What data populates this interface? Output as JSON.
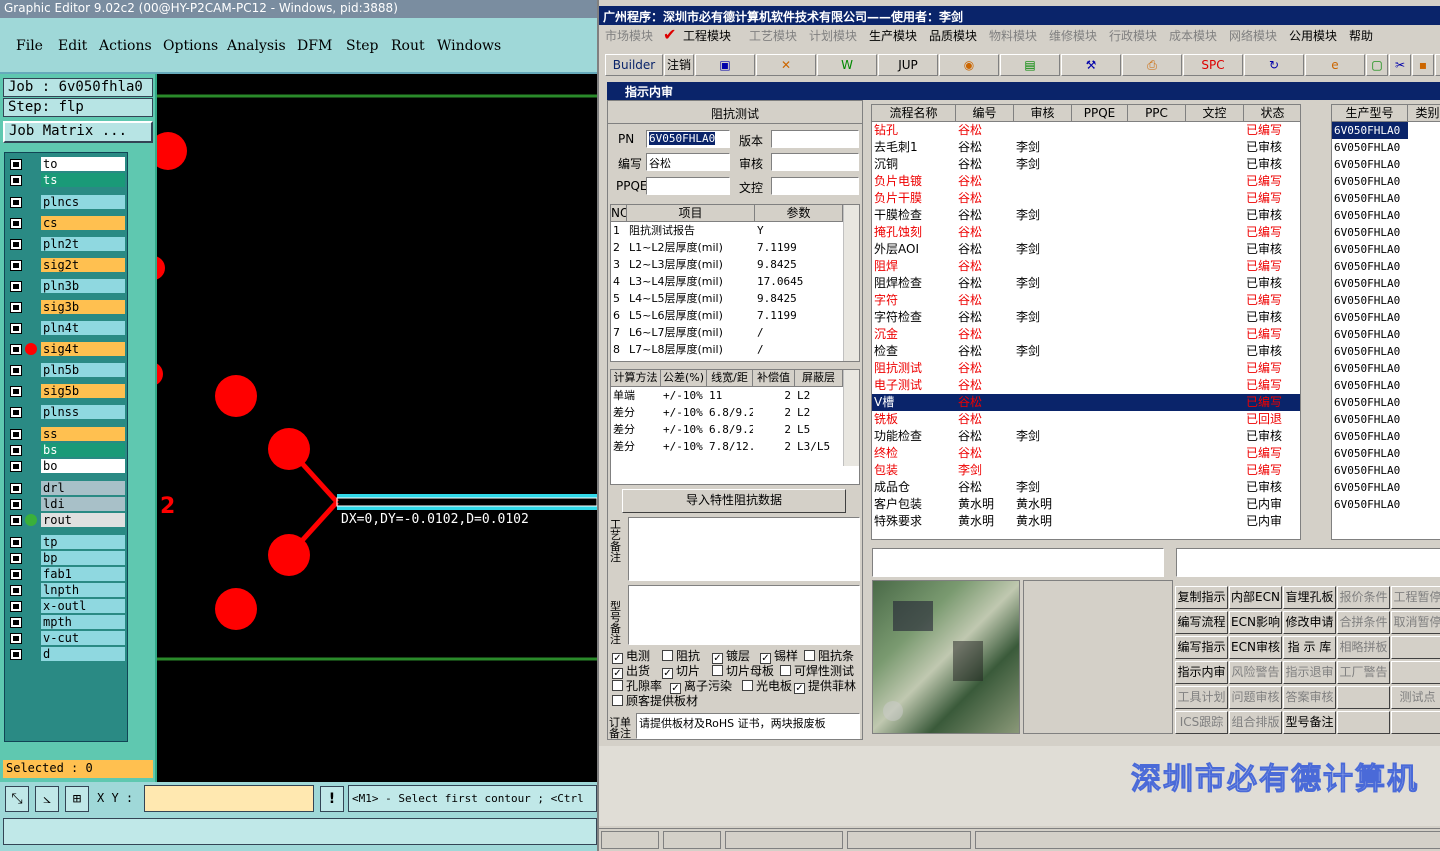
{
  "ge": {
    "title": "Graphic Editor 9.02c2 (00@HY-P2CAM-PC12 - Windows, pid:3888)",
    "menu": [
      "File",
      "Edit",
      "Actions",
      "Options",
      "Analysis",
      "DFM",
      "Step",
      "Rout",
      "Windows"
    ],
    "job": "Job  : 6v050fhla0",
    "step": "Step: flp",
    "job_matrix": "Job Matrix ...",
    "layers": [
      {
        "name": "to",
        "color": "#ffffff"
      },
      {
        "name": "ts",
        "color": "#1a9a78"
      },
      {
        "name": "plncs",
        "color": "#8fd8e0"
      },
      {
        "name": "cs",
        "color": "#ffc050"
      },
      {
        "name": "pln2t",
        "color": "#8fd8e0"
      },
      {
        "name": "sig2t",
        "color": "#ffc050"
      },
      {
        "name": "pln3b",
        "color": "#8fd8e0"
      },
      {
        "name": "sig3b",
        "color": "#ffc050"
      },
      {
        "name": "pln4t",
        "color": "#8fd8e0"
      },
      {
        "name": "sig4t",
        "color": "#ffc050"
      },
      {
        "name": "pln5b",
        "color": "#8fd8e0"
      },
      {
        "name": "sig5b",
        "color": "#ffc050"
      },
      {
        "name": "plnss",
        "color": "#8fd8e0"
      },
      {
        "name": "ss",
        "color": "#ffc050"
      },
      {
        "name": "bs",
        "color": "#1a9a78"
      },
      {
        "name": "bo",
        "color": "#ffffff"
      },
      {
        "name": "drl",
        "color": "#a8c0c8"
      },
      {
        "name": "ldi",
        "color": "#a8c0c8"
      },
      {
        "name": "rout",
        "color": "#e0e0e0"
      },
      {
        "name": "tp",
        "color": "#8fd8e0"
      },
      {
        "name": "bp",
        "color": "#8fd8e0"
      },
      {
        "name": "fab1",
        "color": "#8fd8e0"
      },
      {
        "name": "lnpth",
        "color": "#8fd8e0"
      },
      {
        "name": "x-outl",
        "color": "#8fd8e0"
      },
      {
        "name": "mpth",
        "color": "#8fd8e0"
      },
      {
        "name": "v-cut",
        "color": "#8fd8e0"
      },
      {
        "name": "d",
        "color": "#8fd8e0"
      }
    ],
    "selected": "Selected : 0",
    "measure": "DX=0,DY=-0.0102,D=0.0102",
    "marker": "2",
    "xy_label": "X Y :",
    "status": "<M1> - Select first contour ; <Ctrl"
  },
  "erp": {
    "title": "广州程序：深圳市必有德计算机软件技术有限公司——使用者：李剑",
    "menu": [
      "市场模块",
      "工程模块",
      "工艺模块",
      "计划模块",
      "生产模块",
      "品质模块",
      "物料模块",
      "维修模块",
      "行政模块",
      "成本模块",
      "网络模块",
      "公用模块",
      "帮助"
    ],
    "toolbar": [
      "Builder",
      "注销",
      "",
      "",
      "",
      "JUP",
      "",
      "",
      "",
      "",
      "SPC",
      "",
      "",
      "",
      "",
      "",
      "",
      ""
    ],
    "sub_title": "指示内审",
    "imp": {
      "header": "阻抗测试",
      "pn_label": "PN",
      "pn": "6V050FHLA0",
      "ver_label": "版本",
      "code_label": "编写",
      "code": "谷松",
      "audit_label": "审核",
      "ppqe_label": "PPQE",
      "doc_label": "文控",
      "cols": [
        "NO",
        "项目",
        "参数"
      ],
      "rows": [
        [
          "1",
          "阻抗测试报告",
          "Y"
        ],
        [
          "2",
          "L1~L2层厚度(mil)",
          "7.1199"
        ],
        [
          "3",
          "L2~L3层厚度(mil)",
          "9.8425"
        ],
        [
          "4",
          "L3~L4层厚度(mil)",
          "17.0645"
        ],
        [
          "5",
          "L4~L5层厚度(mil)",
          "9.8425"
        ],
        [
          "6",
          "L5~L6层厚度(mil)",
          "7.1199"
        ],
        [
          "7",
          "L6~L7层厚度(mil)",
          "/"
        ],
        [
          "8",
          "L7~L8层厚度(mil)",
          "/"
        ]
      ],
      "cols2": [
        "计算方法",
        "公差(%)",
        "线宽/距",
        "补偿值",
        "屏蔽层"
      ],
      "rows2": [
        [
          "单端",
          "+/-10%",
          "11",
          "2",
          "L2"
        ],
        [
          "差分",
          "+/-10%",
          "6.8/9.2",
          "2",
          "L2"
        ],
        [
          "差分",
          "+/-10%",
          "6.8/9.2",
          "2",
          "L5"
        ],
        [
          "差分",
          "+/-10%",
          "7.8/12.",
          "2",
          "L3/L5"
        ]
      ],
      "import_btn": "导入特性阻抗数据",
      "note1": "工艺备注",
      "note2": "型号备注",
      "note3": "订单备注",
      "checks": [
        {
          "t": "电测",
          "v": true
        },
        {
          "t": "阻抗",
          "v": false
        },
        {
          "t": "镀层",
          "v": true
        },
        {
          "t": "锡样",
          "v": true
        },
        {
          "t": "阻抗条",
          "v": false
        },
        {
          "t": "出货",
          "v": true
        },
        {
          "t": "切片",
          "v": true
        },
        {
          "t": "切片母板",
          "v": false
        },
        {
          "t": "可焊性测试",
          "v": false
        },
        {
          "t": "孔隙率",
          "v": false
        },
        {
          "t": "离子污染",
          "v": true
        },
        {
          "t": "光电板",
          "v": false
        },
        {
          "t": "提供菲林",
          "v": true
        },
        {
          "t": "顾客提供板材",
          "v": false
        }
      ],
      "order_note": "请提供板材及RoHS 证书，两块报废板"
    },
    "flow": {
      "cols": [
        "流程名称",
        "编号",
        "审核",
        "PPQE",
        "PPC",
        "文控",
        "状态"
      ],
      "rows": [
        [
          "钻孔",
          "谷松",
          "",
          "已编写",
          "r"
        ],
        [
          "去毛刺1",
          "谷松",
          "李剑",
          "已审核",
          ""
        ],
        [
          "沉铜",
          "谷松",
          "李剑",
          "已审核",
          ""
        ],
        [
          "负片电镀",
          "谷松",
          "",
          "已编写",
          "r"
        ],
        [
          "负片干膜",
          "谷松",
          "",
          "已编写",
          "r"
        ],
        [
          "干膜检查",
          "谷松",
          "李剑",
          "已审核",
          ""
        ],
        [
          "掩孔蚀刻",
          "谷松",
          "",
          "已编写",
          "r"
        ],
        [
          "外层AOI",
          "谷松",
          "李剑",
          "已审核",
          ""
        ],
        [
          "阻焊",
          "谷松",
          "",
          "已编写",
          "r"
        ],
        [
          "阻焊检查",
          "谷松",
          "李剑",
          "已审核",
          ""
        ],
        [
          "字符",
          "谷松",
          "",
          "已编写",
          "r"
        ],
        [
          "字符检查",
          "谷松",
          "李剑",
          "已审核",
          ""
        ],
        [
          "沉金",
          "谷松",
          "",
          "已编写",
          "r"
        ],
        [
          "检查",
          "谷松",
          "李剑",
          "已审核",
          ""
        ],
        [
          "阻抗测试",
          "谷松",
          "",
          "已编写",
          "r"
        ],
        [
          "电子测试",
          "谷松",
          "",
          "已编写",
          "r"
        ],
        [
          "V槽",
          "谷松",
          "",
          "已编写",
          "s"
        ],
        [
          "铣板",
          "谷松",
          "",
          "已回退",
          "r"
        ],
        [
          "功能检查",
          "谷松",
          "李剑",
          "已审核",
          ""
        ],
        [
          "终检",
          "谷松",
          "",
          "已编写",
          "r"
        ],
        [
          "包装",
          "李剑",
          "",
          "已编写",
          "r"
        ],
        [
          "成品仓",
          "谷松",
          "李剑",
          "已审核",
          ""
        ],
        [
          "客户包装",
          "黄水明",
          "黄水明",
          "已内审",
          ""
        ],
        [
          "特殊要求",
          "黄水明",
          "黄水明",
          "已内审",
          ""
        ]
      ]
    },
    "models": {
      "cols": [
        "生产型号",
        "类别"
      ],
      "rows": [
        "6V050FHLA0",
        "6V050FHLA0",
        "6V050FHLA0",
        "6V050FHLA0",
        "6V050FHLA0",
        "6V050FHLA0",
        "6V050FHLA0",
        "6V050FHLA0",
        "6V050FHLA0",
        "6V050FHLA0",
        "6V050FHLA0",
        "6V050FHLA0",
        "6V050FHLA0",
        "6V050FHLA0",
        "6V050FHLA0",
        "6V050FHLA0",
        "6V050FHLA0",
        "6V050FHLA0",
        "6V050FHLA0",
        "6V050FHLA0",
        "6V050FHLA0",
        "6V050FHLA0",
        "6V050FHLA0"
      ]
    },
    "buttons": [
      [
        "复制指示",
        "内部ECN",
        "盲埋孔板",
        "报价条件",
        "工程暂停"
      ],
      [
        "编写流程",
        "ECN影响",
        "修改申请",
        "合拼条件",
        "取消暂停"
      ],
      [
        "编写指示",
        "ECN审核",
        "指 示 库",
        "相略拼板",
        ""
      ],
      [
        "指示内审",
        "风险警告",
        "指示退审",
        "工厂警告",
        ""
      ],
      [
        "工具计划",
        "问题审核",
        "答案审核",
        "",
        "测试点"
      ],
      [
        "ICS跟踪",
        "组合排版",
        "型号备注",
        "",
        ""
      ]
    ],
    "banner": "深圳市必有德计算机"
  },
  "colors": {
    "accent": "#0a246a",
    "red": "#ff0000"
  }
}
